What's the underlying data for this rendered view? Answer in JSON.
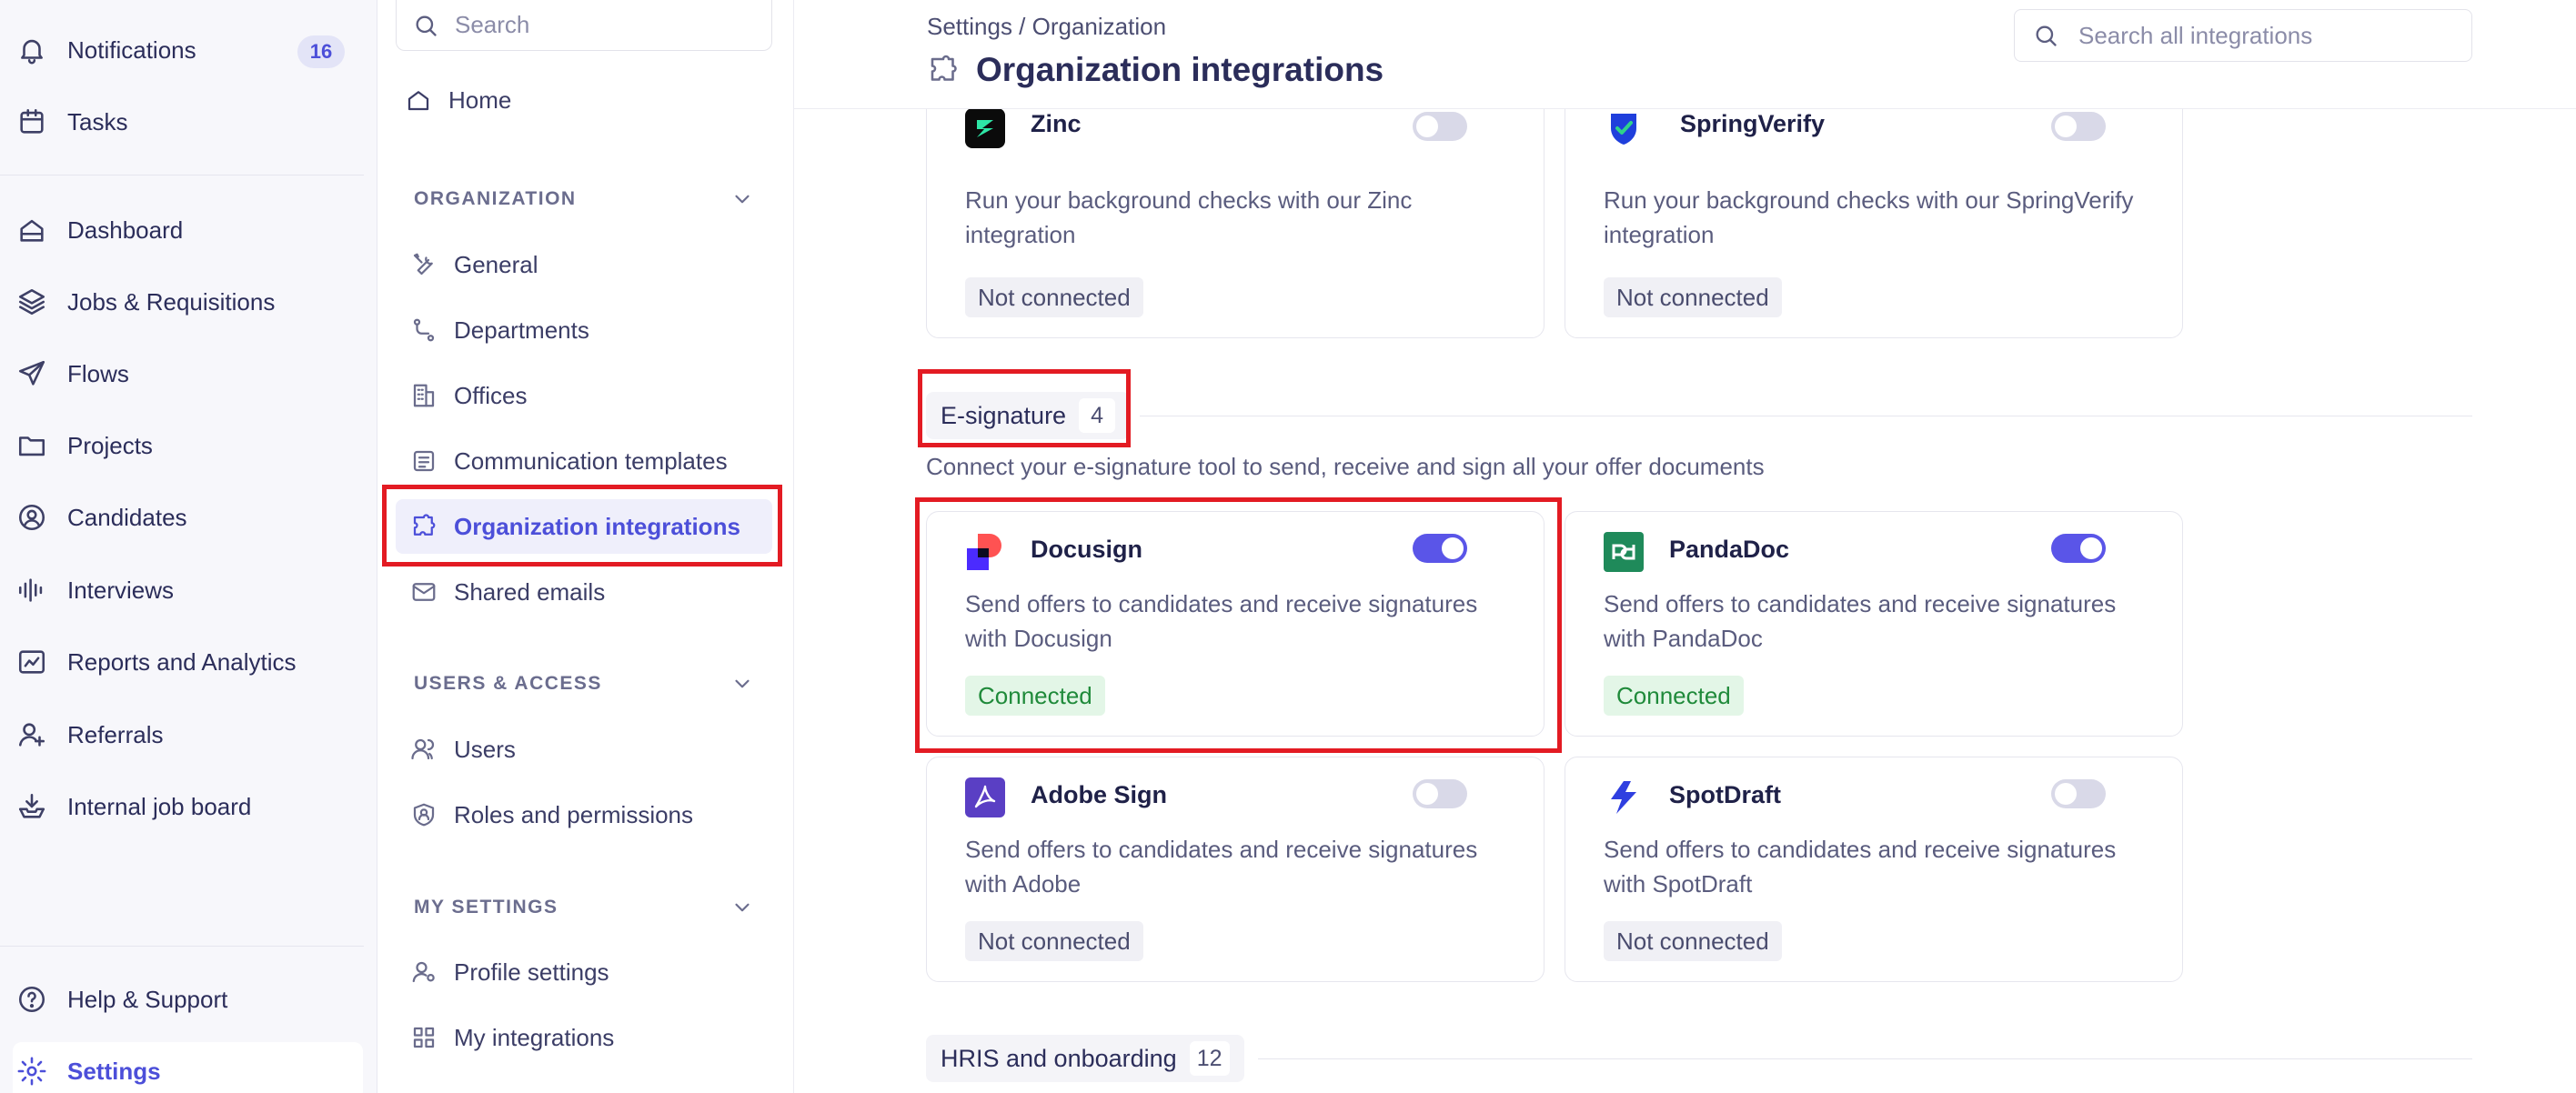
{
  "leftnav": {
    "notifications": {
      "label": "Notifications",
      "count": "16"
    },
    "tasks": "Tasks",
    "dashboard": "Dashboard",
    "jobs": "Jobs & Requisitions",
    "flows": "Flows",
    "projects": "Projects",
    "candidates": "Candidates",
    "interviews": "Interviews",
    "reports": "Reports and Analytics",
    "referrals": "Referrals",
    "job_board": "Internal job board",
    "help": "Help & Support",
    "settings": "Settings"
  },
  "subnav": {
    "search_placeholder": "Search",
    "home": "Home",
    "organization_header": "ORGANIZATION",
    "general": "General",
    "departments": "Departments",
    "offices": "Offices",
    "comm_templates": "Communication templates",
    "org_integrations": "Organization integrations",
    "shared_emails": "Shared emails",
    "users_access_header": "USERS & ACCESS",
    "users": "Users",
    "roles": "Roles and permissions",
    "my_settings_header": "MY SETTINGS",
    "profile_settings": "Profile settings",
    "my_integrations": "My integrations"
  },
  "header": {
    "breadcrumb": "Settings / Organization",
    "title": "Organization integrations",
    "search_placeholder": "Search all integrations"
  },
  "cards_top": [
    {
      "name": "Zinc",
      "desc": "Run your background checks with our Zinc integration",
      "status": "Not connected",
      "enabled": false
    },
    {
      "name": "SpringVerify",
      "desc": "Run your background checks with our SpringVerify integration",
      "status": "Not connected",
      "enabled": false
    }
  ],
  "esignature": {
    "title": "E-signature",
    "count": "4",
    "description": "Connect your e-signature tool to send, receive and sign all your offer documents",
    "cards": [
      {
        "name": "Docusign",
        "desc": "Send offers to candidates and receive signatures with Docusign",
        "status": "Connected",
        "enabled": true
      },
      {
        "name": "PandaDoc",
        "desc": "Send offers to candidates and receive signatures with PandaDoc",
        "status": "Connected",
        "enabled": true
      },
      {
        "name": "Adobe Sign",
        "desc": "Send offers to candidates and receive signatures with Adobe",
        "status": "Not connected",
        "enabled": false
      },
      {
        "name": "SpotDraft",
        "desc": "Send offers to candidates and receive signatures with SpotDraft",
        "status": "Not connected",
        "enabled": false
      }
    ]
  },
  "hris": {
    "title": "HRIS and onboarding",
    "count": "12"
  },
  "colors": {
    "accent": "#4c4fd9",
    "toggle_on": "#5a55e8",
    "connected_green": "#1f8a3a",
    "highlight_red": "#e31b23"
  }
}
